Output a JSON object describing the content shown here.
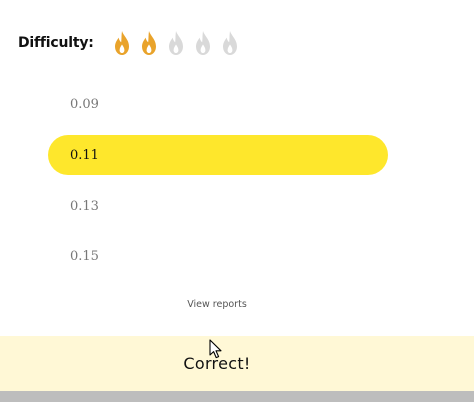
{
  "difficulty": {
    "label": "Difficulty:",
    "level": 2,
    "max": 5,
    "active_color": "#e9a32b",
    "inactive_color": "#d9d9d9",
    "icon": "flame-icon"
  },
  "options": [
    {
      "label": "0.09",
      "selected": false
    },
    {
      "label": "0.11",
      "selected": true
    },
    {
      "label": "0.13",
      "selected": false
    },
    {
      "label": "0.15",
      "selected": false
    }
  ],
  "selected_color": "#fee72c",
  "view_reports_label": "View reports",
  "feedback": {
    "text": "Correct!",
    "background": "#fff8d6"
  }
}
